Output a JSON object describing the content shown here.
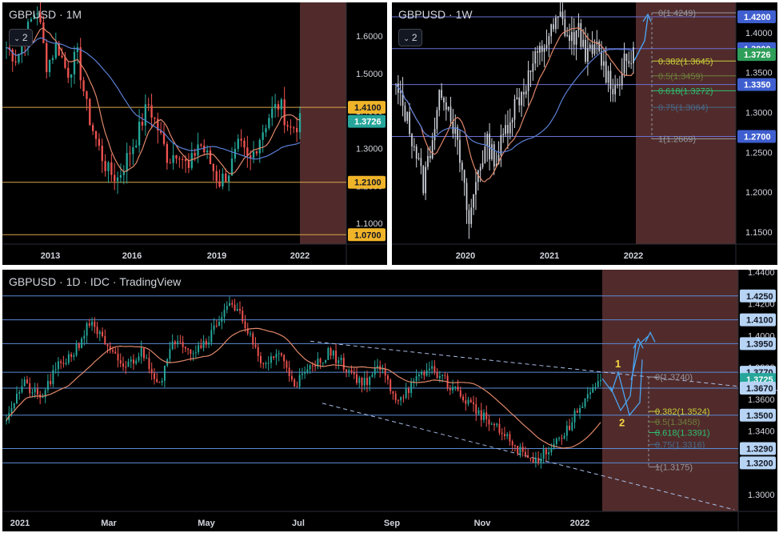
{
  "monthly": {
    "title": "GBPUSD · 1M",
    "collapse_label": "2",
    "colors": {
      "up": "#26a69a",
      "down": "#ef5350",
      "ma_slow": "#5b7fd6",
      "ma_fast": "#e0876a",
      "zone": "#5a3030",
      "level": "#d9a64a"
    },
    "chart_data": {
      "type": "candlestick",
      "ylim": [
        1.045,
        1.69
      ],
      "y_ticks": [
        "1.6000",
        "1.5000",
        "1.4000",
        "1.3000",
        "1.2000",
        "1.1000"
      ],
      "x_ticks": [
        "2013",
        "2016",
        "2019",
        "2022"
      ],
      "price_labels": [
        {
          "value": 1.41,
          "text": "1.4100",
          "style": "level"
        },
        {
          "value": 1.3726,
          "text": "1.3726",
          "style": "current"
        },
        {
          "value": 1.21,
          "text": "1.2100",
          "style": "level"
        },
        {
          "value": 1.07,
          "text": "1.0700",
          "style": "level"
        }
      ],
      "horizontal_levels": [
        1.41,
        1.21,
        1.07
      ],
      "path": [
        1.57,
        1.54,
        1.61,
        1.68,
        1.52,
        1.58,
        1.5,
        1.55,
        1.4,
        1.31,
        1.24,
        1.22,
        1.28,
        1.34,
        1.42,
        1.35,
        1.27,
        1.3,
        1.24,
        1.32,
        1.27,
        1.21,
        1.24,
        1.31,
        1.26,
        1.33,
        1.39,
        1.42,
        1.35,
        1.37
      ]
    }
  },
  "weekly": {
    "title": "GBPUSD · 1W",
    "collapse_label": "2",
    "colors": {
      "up": "#d1d4dc",
      "down": "#d1d4dc",
      "ma_slow": "#5b7fd6",
      "ma_fast": "#e0876a",
      "zone": "#5a3030",
      "level": "#6b6fd6",
      "blue": "#3f6fd8",
      "green": "#2e9e58"
    },
    "chart_data": {
      "type": "candlestick",
      "ylim": [
        1.135,
        1.438
      ],
      "y_ticks": [
        "1.4000",
        "1.3500",
        "1.3000",
        "1.2500",
        "1.2000",
        "1.1500"
      ],
      "x_ticks": [
        "2020",
        "2021",
        "2022"
      ],
      "price_labels": [
        {
          "value": 1.42,
          "text": "1.4200",
          "style": "blue"
        },
        {
          "value": 1.38,
          "text": "1.3800",
          "style": "blue"
        },
        {
          "value": 1.3726,
          "text": "1.3726",
          "style": "green"
        },
        {
          "value": 1.335,
          "text": "1.3350",
          "style": "blue"
        },
        {
          "value": 1.27,
          "text": "1.2700",
          "style": "blue"
        }
      ],
      "horizontal_levels": [
        1.42,
        1.38,
        1.335,
        1.27
      ],
      "fibonacci": [
        {
          "value": 1.4249,
          "text": "0(1.4249)",
          "color": "#9598a1"
        },
        {
          "value": 1.3645,
          "text": "0.382(1.3645)",
          "color": "#c9d03a"
        },
        {
          "value": 1.3459,
          "text": "0.5(1.3459)",
          "color": "#6d7f3a"
        },
        {
          "value": 1.3272,
          "text": "0.618(1.3272)",
          "color": "#2fbf71"
        },
        {
          "value": 1.3064,
          "text": "0.75(1.3064)",
          "color": "#486a8a"
        },
        {
          "value": 1.2669,
          "text": "1(1.2669)",
          "color": "#9598a1"
        }
      ],
      "path": [
        1.33,
        1.3,
        1.26,
        1.21,
        1.27,
        1.33,
        1.3,
        1.24,
        1.16,
        1.23,
        1.26,
        1.24,
        1.28,
        1.31,
        1.33,
        1.36,
        1.38,
        1.4,
        1.42,
        1.39,
        1.4,
        1.37,
        1.38,
        1.35,
        1.33,
        1.36,
        1.37
      ]
    }
  },
  "daily": {
    "title": "GBPUSD · 1D · IDC · TradingView",
    "colors": {
      "up": "#26a69a",
      "down": "#ef5350",
      "ma_fast": "#e0876a",
      "zone": "#5a3030",
      "level": "#5b8bd6",
      "label_bg": "#b7d4f5",
      "current": "#26a69a",
      "trend": "#a8bde8",
      "wave_label": "#f5d442",
      "arrow": "#4aa3f0"
    },
    "chart_data": {
      "type": "candlestick",
      "ylim": [
        1.2895,
        1.4415
      ],
      "y_ticks": [
        "1.4400",
        "1.4200",
        "1.4000",
        "1.3800",
        "1.3600",
        "1.3400",
        "1.3200",
        "1.3000"
      ],
      "x_ticks": [
        "2021",
        "Mar",
        "May",
        "Jul",
        "Sep",
        "Nov",
        "2022"
      ],
      "price_labels": [
        {
          "value": 1.425,
          "text": "1.4250",
          "style": "level"
        },
        {
          "value": 1.41,
          "text": "1.4100",
          "style": "level"
        },
        {
          "value": 1.395,
          "text": "1.3950",
          "style": "level"
        },
        {
          "value": 1.377,
          "text": "1.3770",
          "style": "level"
        },
        {
          "value": 1.3725,
          "text": "1.3725",
          "style": "current"
        },
        {
          "value": 1.367,
          "text": "1.3670",
          "style": "level"
        },
        {
          "value": 1.35,
          "text": "1.3500",
          "style": "level"
        },
        {
          "value": 1.329,
          "text": "1.3290",
          "style": "level"
        },
        {
          "value": 1.32,
          "text": "1.3200",
          "style": "level"
        }
      ],
      "horizontal_levels": [
        1.425,
        1.41,
        1.395,
        1.377,
        1.367,
        1.35,
        1.329,
        1.32
      ],
      "fibonacci": [
        {
          "value": 1.374,
          "text": "0(1.3740)",
          "color": "#9598a1"
        },
        {
          "value": 1.3524,
          "text": "0.382(1.3524)",
          "color": "#c9d03a"
        },
        {
          "value": 1.3458,
          "text": "0.5(1.3458)",
          "color": "#6d7f3a"
        },
        {
          "value": 1.3391,
          "text": "0.618(1.3391)",
          "color": "#2fbf71"
        },
        {
          "value": 1.3316,
          "text": "0.75(1.3316)",
          "color": "#486a8a"
        },
        {
          "value": 1.3175,
          "text": "1(1.3175)",
          "color": "#9598a1"
        }
      ],
      "wave_labels": [
        "1",
        "2"
      ],
      "path": [
        1.35,
        1.37,
        1.36,
        1.38,
        1.39,
        1.41,
        1.39,
        1.38,
        1.39,
        1.37,
        1.4,
        1.39,
        1.4,
        1.42,
        1.41,
        1.38,
        1.39,
        1.37,
        1.38,
        1.39,
        1.38,
        1.37,
        1.38,
        1.36,
        1.37,
        1.38,
        1.37,
        1.36,
        1.35,
        1.34,
        1.33,
        1.32,
        1.33,
        1.34,
        1.36,
        1.37
      ]
    }
  }
}
